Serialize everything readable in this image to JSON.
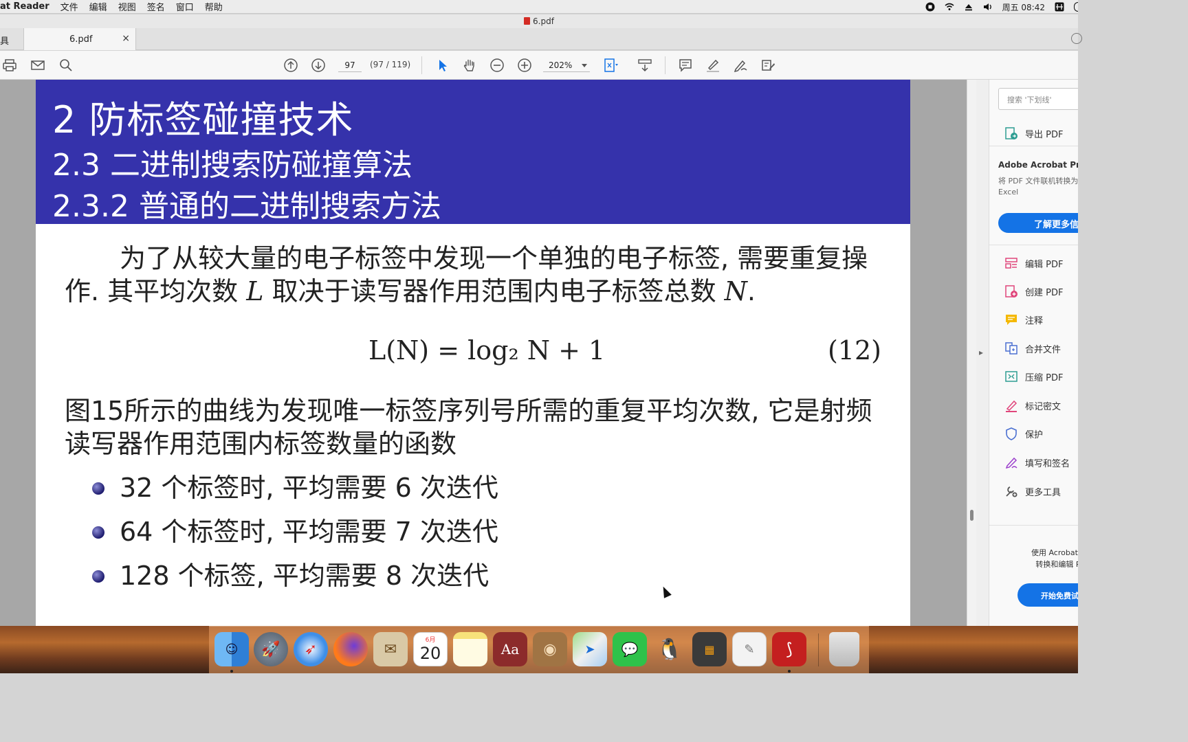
{
  "menubar": {
    "app_name": "at Reader",
    "items": [
      "文件",
      "编辑",
      "视图",
      "签名",
      "窗口",
      "帮助"
    ],
    "clock": "周五 08:42"
  },
  "window": {
    "title": "6.pdf"
  },
  "tabs": {
    "tools_label": "具",
    "active_tab": "6.pdf"
  },
  "toolbar": {
    "page_current": "97",
    "page_count": "(97 / 119)",
    "zoom": "202%"
  },
  "slide": {
    "h1": "2 防标签碰撞技术",
    "h2": "2.3 二进制搜索防碰撞算法",
    "h3": "2.3.2 普通的二进制搜索方法",
    "para1_a": "为了从较大量的电子标签中发现一个单独的电子标签, 需要重复操作. 其平均次数 ",
    "para1_L": "L",
    "para1_b": " 取决于读写器作用范围内电子标签总数 ",
    "para1_N": "N",
    "para1_c": ".",
    "formula": "L(N) = log₂ N + 1",
    "equation_number": "(12)",
    "para2": "图15所示的曲线为发现唯一标签序列号所需的重复平均次数, 它是射频读写器作用范围内标签数量的函数",
    "bullets": [
      "32 个标签时, 平均需要 6 次迭代",
      "64 个标签时, 平均需要 7 次迭代",
      "128 个标签, 平均需要 8 次迭代"
    ]
  },
  "right_panel": {
    "search_placeholder": "搜索 '下划线'",
    "export_pdf": "导出 PDF",
    "promo_title": "Adobe Acrobat Pro",
    "promo_text": "将 PDF 文件联机转换为 Excel",
    "promo_button": "了解更多信",
    "tools": [
      "编辑 PDF",
      "创建 PDF",
      "注释",
      "合并文件",
      "压缩 PDF",
      "标记密文",
      "保护",
      "填写和签名",
      "更多工具"
    ],
    "bottom_text_1": "使用 Acrobat P",
    "bottom_text_2": "转换和编辑 P",
    "bottom_button": "开始免费试"
  },
  "dock": {
    "calendar_month": "6月",
    "calendar_day": "20",
    "dictionary_label": "Aa"
  },
  "colors": {
    "banner": "#3532ab",
    "accent_blue": "#1473e6",
    "acrobat_red": "#d42c25"
  }
}
